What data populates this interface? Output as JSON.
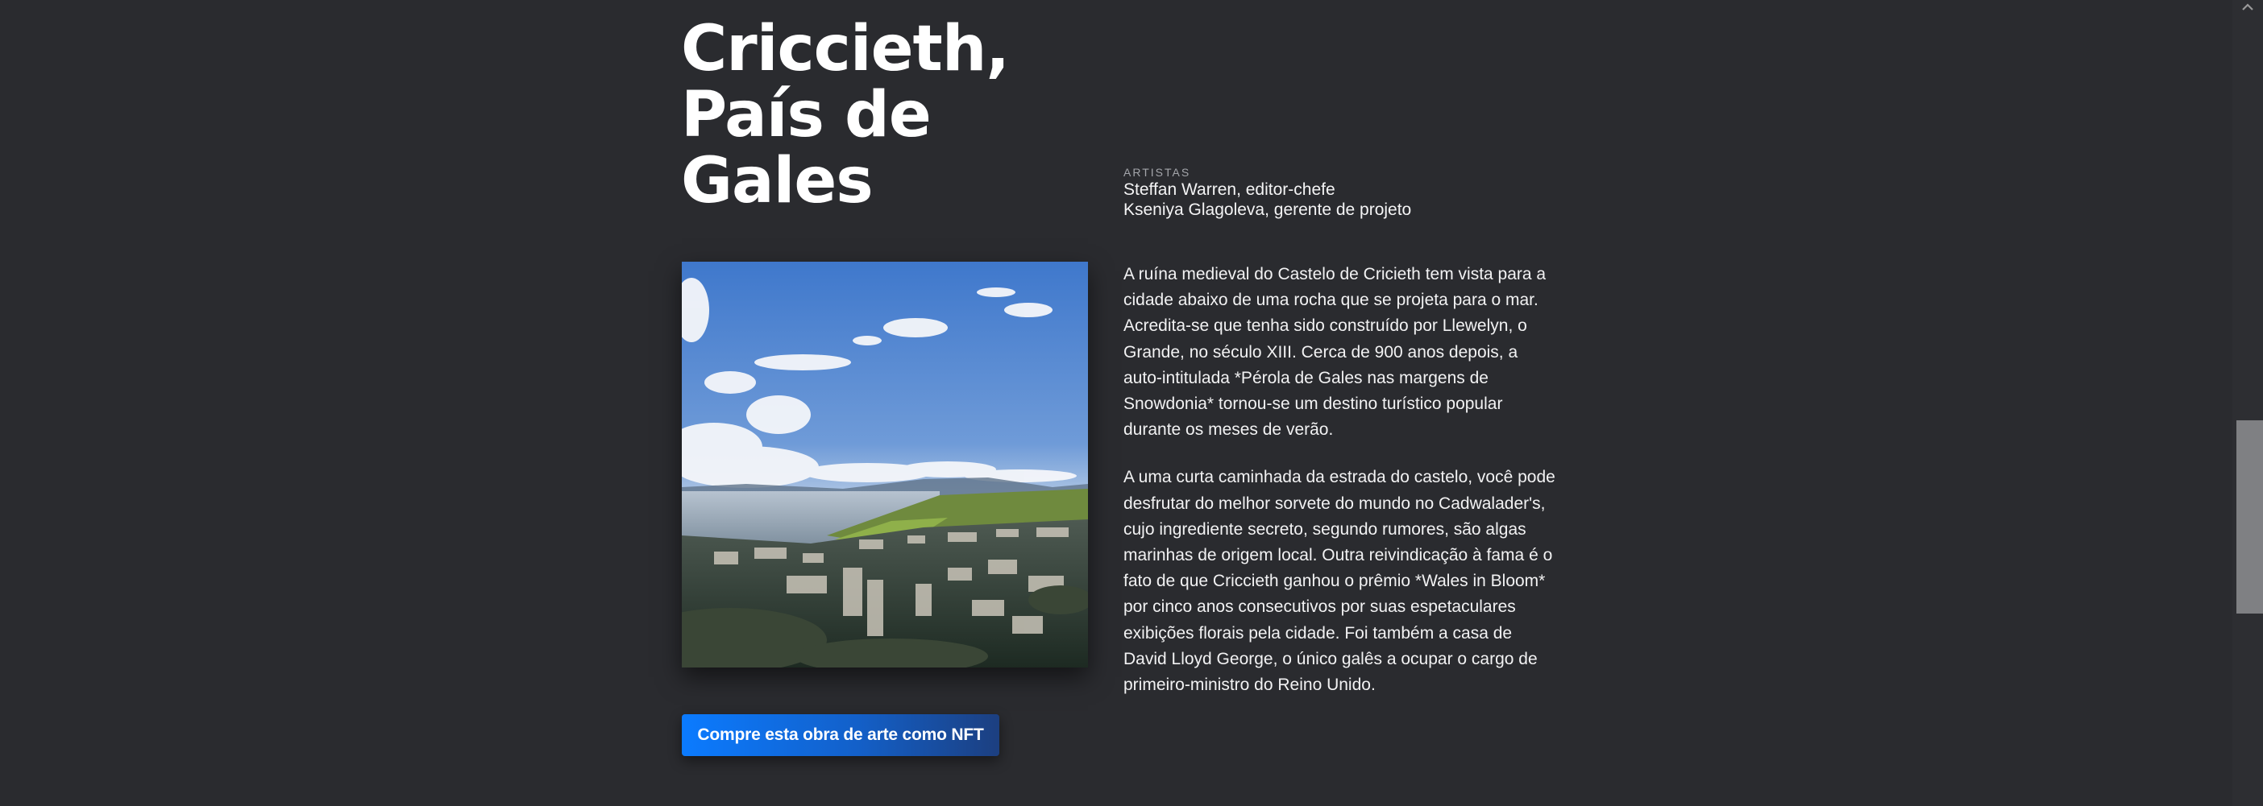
{
  "article": {
    "title_lines": [
      "Criccieth,",
      "País de",
      "Gales"
    ]
  },
  "credits": {
    "label": "ARTISTAS",
    "entries": [
      "Steffan Warren, editor-chefe",
      "Kseniya Glagoleva, gerente de projeto"
    ]
  },
  "artwork": {
    "image_alt": "coastal town photo"
  },
  "description": {
    "paragraphs": [
      "A ruína medieval do Castelo de Cricieth tem vista para a cidade abaixo de uma rocha que se projeta para o mar. Acredita-se que tenha sido construído por Llewelyn, o Grande, no século XIII. Cerca de 900 anos depois, a auto-intitulada *Pérola de Gales nas margens de Snowdonia* tornou-se um destino turístico popular durante os meses de verão.",
      "A uma curta caminhada da estrada do castelo, você pode desfrutar do melhor sorvete do mundo no Cadwalader's, cujo ingrediente secreto, segundo rumores, são algas marinhas de origem local. Outra reivindicação à fama é o fato de que Criccieth ganhou o prêmio *Wales in Bloom* por cinco anos consecutivos por suas espetaculares exibições florais pela cidade. Foi também a casa de David Lloyd George, o único galês a ocupar o cargo de primeiro-ministro do Reino Unido."
    ]
  },
  "cta": {
    "label": "Compre esta obra de arte como NFT"
  },
  "scrollbar": {
    "arrow_icon": "chevron-up-icon"
  },
  "colors": {
    "background": "#2a2b2f",
    "button_start": "#0b7bff",
    "button_end": "#1c3f80"
  }
}
